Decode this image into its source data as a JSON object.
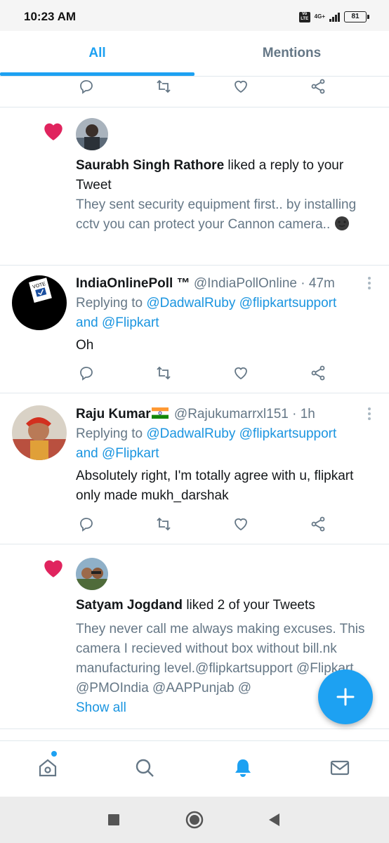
{
  "status_bar": {
    "time": "10:23 AM",
    "volte": "Vo LTE",
    "network": "4G+",
    "battery": "81"
  },
  "tabs": [
    {
      "label": "All",
      "active": true
    },
    {
      "label": "Mentions",
      "active": false
    }
  ],
  "notification_1": {
    "name": "Saurabh Singh Rathore",
    "action": " liked a reply to your Tweet",
    "body": "They sent security equipment first.. by installing cctv you can protect your Cannon camera..",
    "emoji": "new-moon-face-emoji"
  },
  "tweet_1": {
    "name": "IndiaOnlinePoll ™",
    "handle": "@IndiaPollOnline",
    "time": "· 47m",
    "replying_prefix": "Replying to ",
    "mention_1": "@DadwalRuby",
    "mention_2": "@flipkartsupport",
    "and_word": "and ",
    "mention_3": "@Flipkart",
    "body": "Oh",
    "avatar_text": "VOTE"
  },
  "tweet_2": {
    "name": "Raju Kumar",
    "handle": "@Rajukumarrxl151",
    "time": "· 1h",
    "replying_prefix": "Replying to ",
    "mention_1": "@DadwalRuby",
    "mention_2": "@flipkartsupport",
    "and_word": "and ",
    "mention_3": "@Flipkart",
    "body": "Absolutely right, I'm totally agree with u, flipkart only made mukh_darshak"
  },
  "notification_2": {
    "name": "Satyam Jogdand",
    "action": " liked 2 of your Tweets",
    "body": "They never call me always making excuses. This camera I recieved without box without bill.nk manufacturing level.@flipkartsupport @Flipkart @PMOIndia @AAPPunjab @",
    "show_all": "Show all"
  },
  "colors": {
    "accent": "#1da1f2",
    "like": "#e0245e",
    "secondary_text": "#657786"
  },
  "icons": {
    "reply": "reply-icon",
    "retweet": "retweet-icon",
    "like": "like-icon",
    "share": "share-icon",
    "home": "home-icon",
    "search": "search-icon",
    "notifications": "bell-icon",
    "messages": "mail-icon",
    "compose": "plus-icon"
  }
}
